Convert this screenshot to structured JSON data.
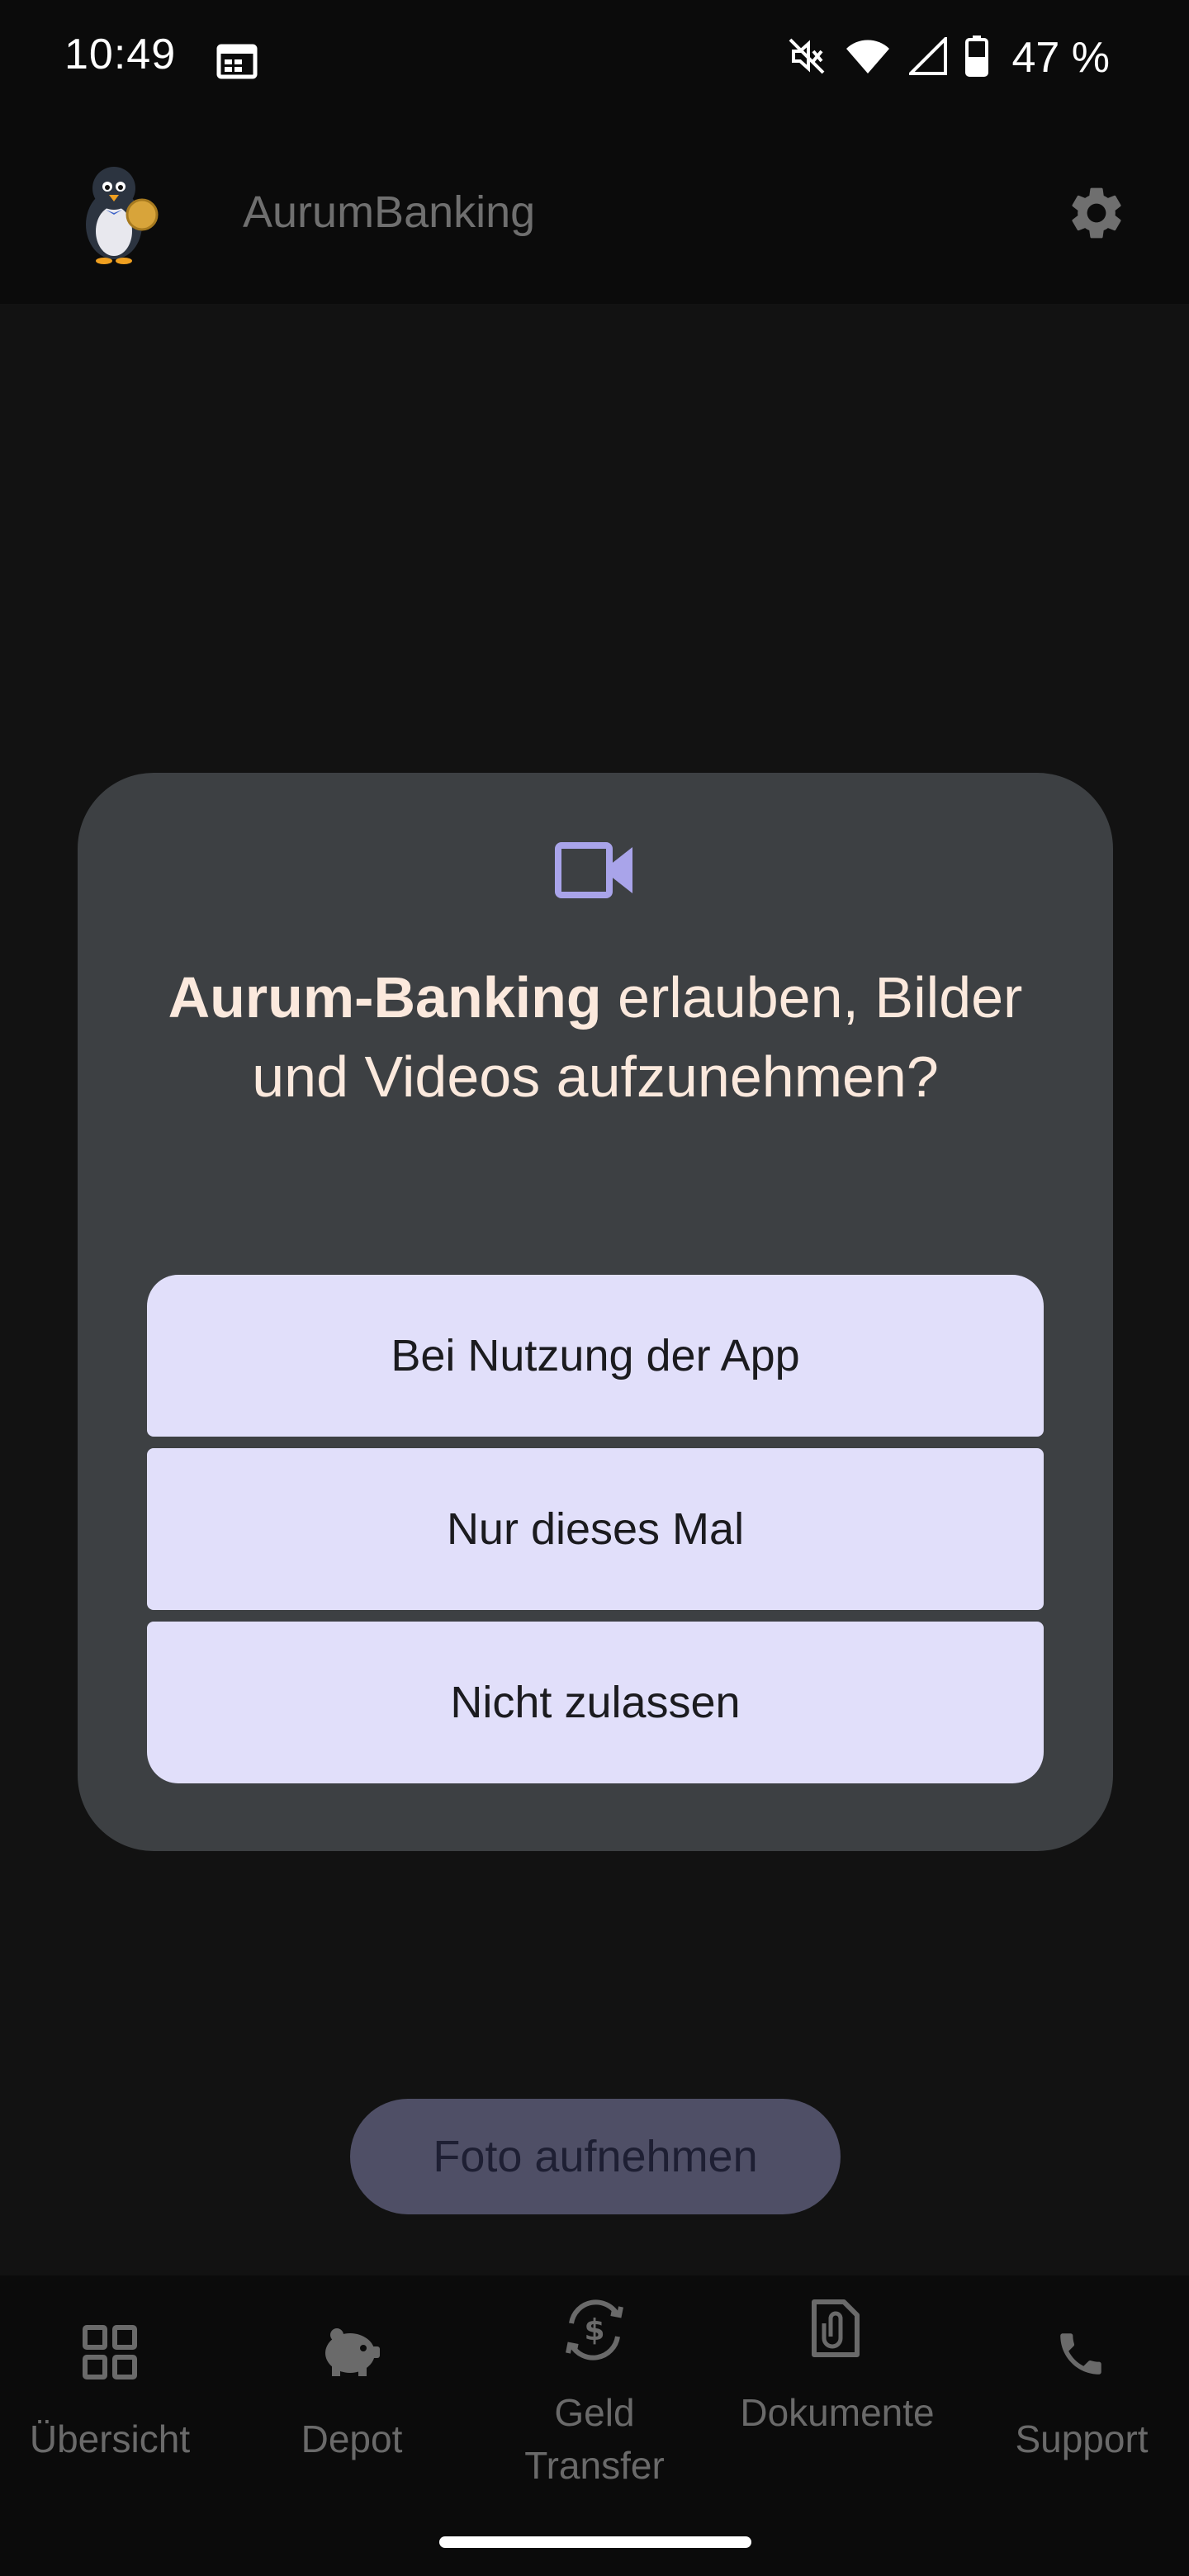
{
  "status_bar": {
    "time": "10:49",
    "battery_text": "47 %",
    "icons": [
      "calendar-icon",
      "mute-icon",
      "wifi-icon",
      "signal-icon",
      "battery-icon"
    ]
  },
  "app_bar": {
    "title": "AurumBanking",
    "logo": "penguin-logo",
    "settings_icon": "gear-icon"
  },
  "dialog": {
    "icon": "videocam-icon",
    "title_app": "Aurum-Banking",
    "title_rest": " erlauben, Bilder und Videos aufzunehmen?",
    "buttons": {
      "while_using": "Bei Nutzung der App",
      "only_this_time": "Nur dieses Mal",
      "deny": "Nicht zulassen"
    }
  },
  "photo_button": "Foto aufnehmen",
  "bottom_nav": {
    "overview": "Übersicht",
    "depot": "Depot",
    "transfer": "Geld Transfer",
    "documents": "Dokumente",
    "support": "Support"
  },
  "colors": {
    "dialog_bg": "#3d4043",
    "button_bg": "#e1dffa",
    "title_text": "#fbe9dd",
    "icon_accent": "#a9a4ea",
    "nav_text": "#6a6a6a"
  }
}
